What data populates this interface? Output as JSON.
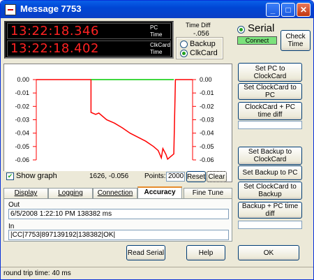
{
  "window": {
    "title": "Message 7753",
    "minimize": "_",
    "maximize": "□",
    "close": "✕"
  },
  "display": {
    "pc_time": "13:22:18.346",
    "pc_label_1": "PC",
    "pc_label_2": "Time",
    "clk_time": "13:22:18.402",
    "clk_label_1": "ClkCard",
    "clk_label_2": "Time",
    "time_diff_label": "Time Diff",
    "time_diff_value": "-.056"
  },
  "source": {
    "backup": "Backup",
    "clkcard": "ClkCard",
    "selected": "ClkCard",
    "serial": "Serial",
    "connect": "Connect",
    "connect_color": "#7ce27c",
    "check_time_1": "Check",
    "check_time_2": "Time"
  },
  "chart_data": {
    "type": "line",
    "yticks": [
      "0.00",
      "-0.01",
      "-0.02",
      "-0.03",
      "-0.04",
      "-0.05",
      "-0.06"
    ],
    "ylim": [
      -0.06,
      0.0
    ],
    "xlim": [
      0,
      2000
    ],
    "series": [
      {
        "color": "#ff0000",
        "x": [
          0,
          700,
          700,
          760,
          800,
          900,
          1000,
          1100,
          1200,
          1300,
          1400,
          1500,
          1560,
          1600,
          1620,
          1660,
          1680,
          1760,
          1780,
          2000
        ],
        "y": [
          0.0,
          0.0,
          -0.0245,
          -0.026,
          -0.025,
          -0.03,
          -0.0325,
          -0.036,
          -0.04,
          -0.043,
          -0.046,
          -0.05,
          -0.053,
          -0.0585,
          -0.0515,
          -0.056,
          -0.0595,
          -0.0555,
          0.0,
          0.0
        ]
      },
      {
        "color": "#00cc00",
        "x": [
          700,
          1760
        ],
        "y": [
          0.0,
          0.0
        ]
      }
    ],
    "axis_color": "#ff0000"
  },
  "graph_controls": {
    "show_graph": "Show graph",
    "coords": "1626,  -0.056",
    "points_label": "Points:",
    "points_value": "2000",
    "reset": "Reset",
    "clear": "Clear"
  },
  "tabs": [
    "Display",
    "Logging",
    "Connection",
    "Accuracy",
    "Fine Tune"
  ],
  "accuracy": {
    "out_label": "Out",
    "out_value": "6/5/2008 1:22:10 PM 138382 ms",
    "in_label": "In",
    "in_value": "|CC|7753|897139192|138382|OK|"
  },
  "buttons": {
    "set_pc": "Set PC to ClockCard",
    "set_clk": "Set ClockCard to PC",
    "clk_diff": "ClockCard + PC time diff",
    "set_b2clk": "Set Backup to ClockCard",
    "set_b2pc": "Set Backup to PC",
    "set_clk2b": "Set ClockCard to Backup",
    "backup_diff": "Backup + PC time diff",
    "read_serial": "Read Serial",
    "help": "Help",
    "ok": "OK"
  },
  "status": "round trip time: 40 ms"
}
